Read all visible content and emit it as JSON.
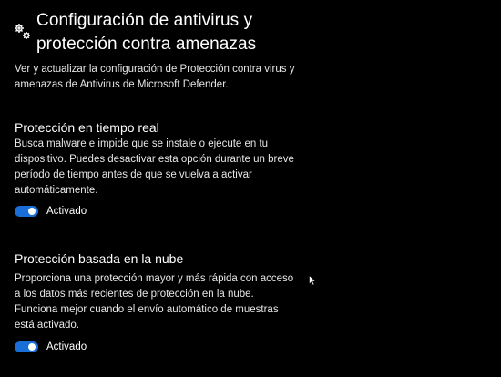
{
  "header": {
    "icon": "gears-icon",
    "title_line1": "Configuración de antivirus y",
    "title_line2": "protección contra amenazas"
  },
  "intro": {
    "line1": "Ver y actualizar la configuración de Protección contra virus y",
    "line2": "amenazas de Antivirus de Microsoft Defender."
  },
  "realtime": {
    "title": "Protección en tiempo real",
    "desc_line1": "Busca malware e impide que se instale o ejecute en tu",
    "desc_line2": "dispositivo. Puedes desactivar esta opción durante un breve",
    "desc_line3": "período de tiempo antes de que se vuelva a activar",
    "desc_line4": "automáticamente.",
    "toggle_state": "on",
    "toggle_label": "Activado"
  },
  "cloud": {
    "title": "Protección basada en la nube",
    "desc_line1": "Proporciona una protección mayor y más rápida con acceso",
    "desc_line2": "a los datos más recientes de protección en la nube.",
    "desc_line3": "Funciona mejor cuando el envío automático de muestras",
    "desc_line4": "está activado.",
    "toggle_state": "on",
    "toggle_label": "Activado"
  },
  "colors": {
    "background": "#000000",
    "toggle_on": "#1a6ed8",
    "text": "#ffffff"
  }
}
